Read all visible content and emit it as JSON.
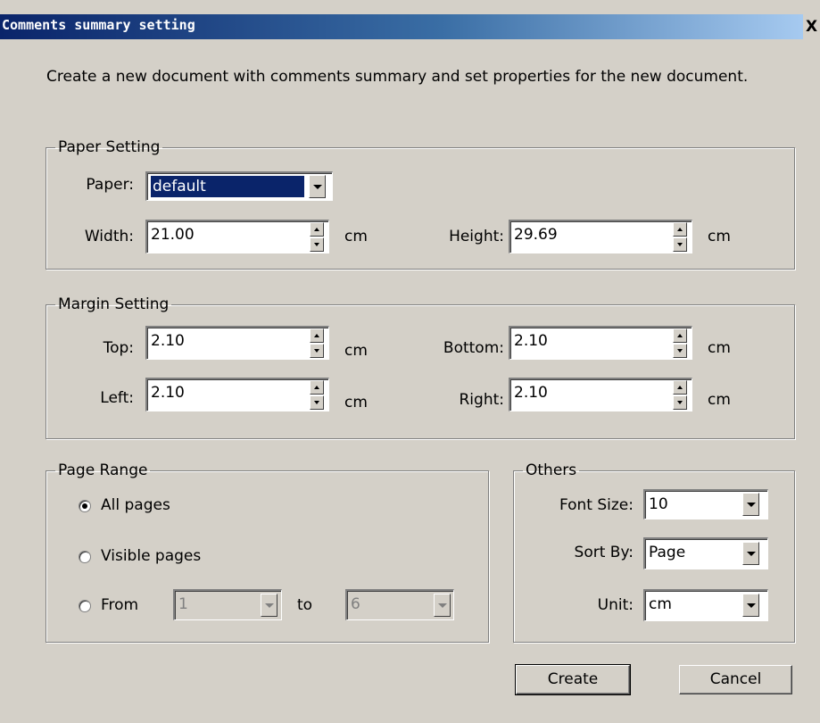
{
  "window": {
    "title": "Comments summary setting",
    "close_label": "X"
  },
  "description": "Create a new document with comments summary and set properties for the new document.",
  "paper_setting": {
    "legend": "Paper Setting",
    "paper_label": "Paper:",
    "paper_value": "default",
    "width_label": "Width:",
    "width_value": "21.00",
    "height_label": "Height:",
    "height_value": "29.69",
    "unit": "cm"
  },
  "margin_setting": {
    "legend": "Margin Setting",
    "top_label": "Top:",
    "top_value": "2.10",
    "bottom_label": "Bottom:",
    "bottom_value": "2.10",
    "left_label": "Left:",
    "left_value": "2.10",
    "right_label": "Right:",
    "right_value": "2.10",
    "unit": "cm"
  },
  "page_range": {
    "legend": "Page Range",
    "all_pages": "All pages",
    "visible_pages": "Visible pages",
    "from_label": "From",
    "from_value": "1",
    "to_label": "to",
    "to_value": "6",
    "selected": "all_pages"
  },
  "others": {
    "legend": "Others",
    "font_size_label": "Font Size:",
    "font_size_value": "10",
    "sort_by_label": "Sort By:",
    "sort_by_value": "Page",
    "unit_label": "Unit:",
    "unit_value": "cm"
  },
  "buttons": {
    "create": "Create",
    "cancel": "Cancel"
  }
}
